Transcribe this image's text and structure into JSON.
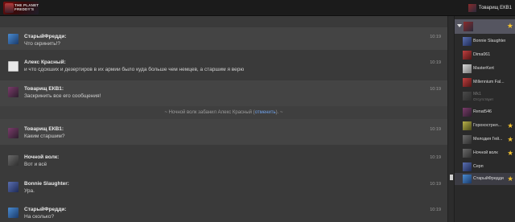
{
  "header": {
    "logo_text": "THE PLANET\nFREDDY'S",
    "current_user": "Товарищ ЕКВ1"
  },
  "messages": [
    {
      "author": "СтарыйФредди:",
      "text": "Что скринить!?",
      "time": "10:19"
    },
    {
      "author": "Алекс Красный:",
      "text": "и что сдохших и дезертиров в их армии было куда больше чем немцев, а старшим я верю",
      "time": "10:19"
    },
    {
      "author": "Товарищ ЕКВ1:",
      "text": "Заскринить все его сообщения!",
      "time": "10:19"
    },
    {
      "author": "Товарищ ЕКВ1:",
      "text": "Каким старшим?",
      "time": "10:19"
    },
    {
      "author": "Ночной волк:",
      "text": "Вот и всё",
      "time": "10:19"
    },
    {
      "author": "Bonnie Slaughter:",
      "text": "Ура.",
      "time": "10:19"
    },
    {
      "author": "СтарыйФредди:",
      "text": "На сколько?",
      "time": "10:19"
    }
  ],
  "system_message": {
    "prefix": "~ Ночной волк забанил Алекс Красный (",
    "link": "отменить",
    "suffix": "). ~"
  },
  "sidebar": {
    "users": [
      {
        "name": "Bonnie Slaughter",
        "star": false
      },
      {
        "name": "Dima061",
        "star": false
      },
      {
        "name": "MasterKert",
        "star": false
      },
      {
        "name": "Millennium Fal...",
        "star": false
      },
      {
        "name": "Mk1",
        "status": "Отсутствует",
        "star": false,
        "dim": true
      },
      {
        "name": "Renat546",
        "star": false
      },
      {
        "name": "Горохострел...",
        "star": true
      },
      {
        "name": "Мелодия Гей...",
        "star": true
      },
      {
        "name": "Ночной волк",
        "star": true
      },
      {
        "name": "Серп",
        "star": false
      },
      {
        "name": "СтарыйФредди",
        "star": true
      }
    ]
  },
  "colors": {
    "star": "#f2c12e",
    "link": "#6fa0e8",
    "background": "#3a3a3a"
  }
}
